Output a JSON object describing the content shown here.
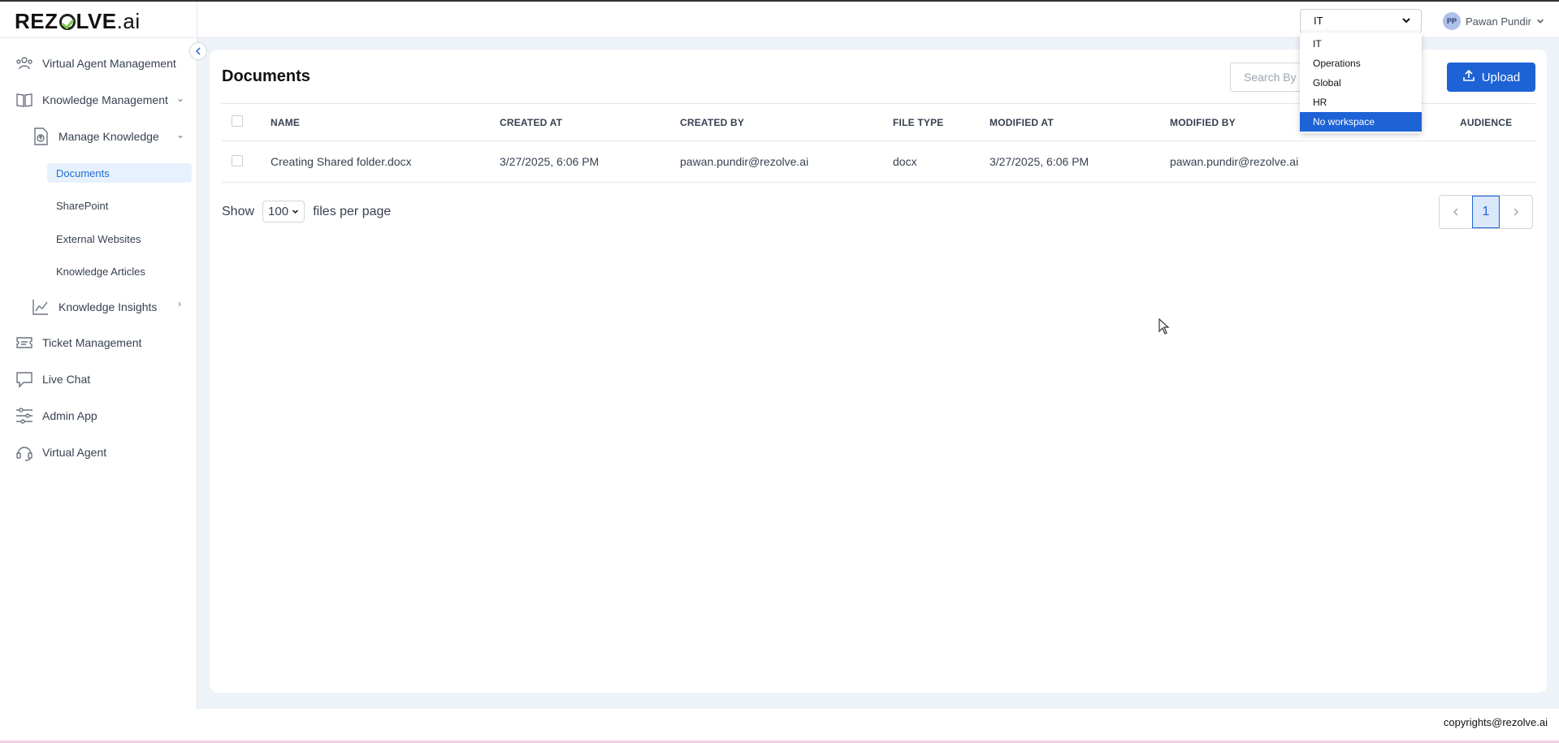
{
  "brand": {
    "logo_pre": "REZ",
    "logo_post": "LVE",
    "logo_suffix": ".ai"
  },
  "header": {
    "workspace_selected": "IT",
    "user_initials": "PP",
    "user_name": "Pawan Pundir"
  },
  "workspace_menu": {
    "options": [
      "IT",
      "Operations",
      "Global",
      "HR",
      "No workspace"
    ],
    "highlighted": "No workspace"
  },
  "sidebar": {
    "items": [
      {
        "label": "Virtual Agent Management",
        "icon": "users-icon"
      },
      {
        "label": "Knowledge Management",
        "icon": "book-icon"
      },
      {
        "label": "Manage Knowledge",
        "icon": "document-upload-icon"
      },
      {
        "label": "Knowledge Insights",
        "icon": "chart-icon"
      },
      {
        "label": "Ticket Management",
        "icon": "ticket-icon"
      },
      {
        "label": "Live Chat",
        "icon": "chat-icon"
      },
      {
        "label": "Admin App",
        "icon": "sliders-icon"
      },
      {
        "label": "Virtual Agent",
        "icon": "headset-icon"
      }
    ],
    "sub_items": [
      "Documents",
      "SharePoint",
      "External Websites",
      "Knowledge Articles"
    ],
    "active": "Documents"
  },
  "main": {
    "title": "Documents",
    "search_placeholder": "Search By",
    "upload_label": "Upload",
    "columns": [
      "NAME",
      "CREATED AT",
      "CREATED BY",
      "FILE TYPE",
      "MODIFIED AT",
      "MODIFIED BY",
      "AUDIENCE"
    ],
    "rows": [
      {
        "name": "Creating Shared folder.docx",
        "created_at": "3/27/2025, 6:06 PM",
        "created_by": "pawan.pundir@rezolve.ai",
        "file_type": "docx",
        "modified_at": "3/27/2025, 6:06 PM",
        "modified_by": "pawan.pundir@rezolve.ai",
        "audience": ""
      }
    ],
    "pagination": {
      "show_label": "Show",
      "per_page": "100",
      "per_page_suffix": "files per page",
      "current_page": "1"
    }
  },
  "footer": {
    "text": "copyrights@rezolve.ai"
  },
  "colors": {
    "accent": "#1e63d6",
    "active_bg": "#e7f1fd"
  }
}
